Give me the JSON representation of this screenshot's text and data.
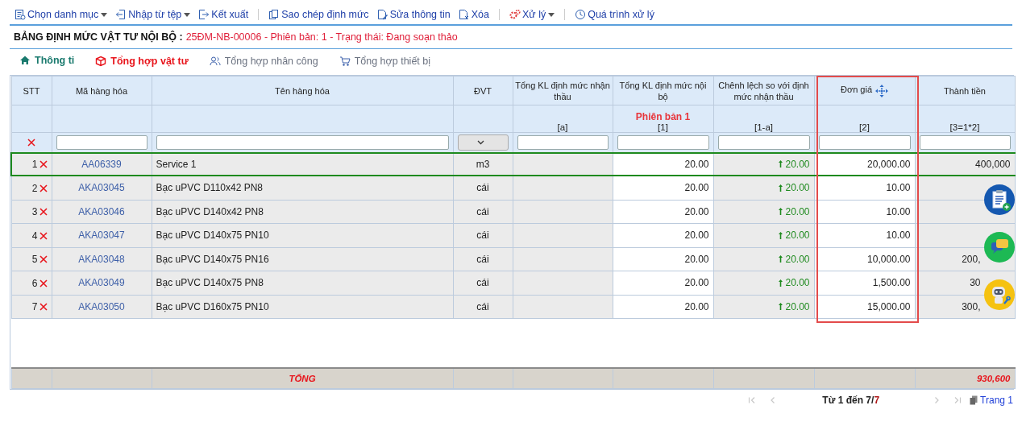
{
  "toolbar_groups": [
    [
      {
        "label": "Chọn danh mục",
        "kind": "list",
        "dropdown": true
      },
      {
        "label": "Nhập từ tệp",
        "kind": "import",
        "dropdown": true
      },
      {
        "label": "Kết xuất",
        "kind": "export",
        "dropdown": false
      }
    ],
    [
      {
        "label": "Sao chép định mức",
        "kind": "copy",
        "dropdown": false
      },
      {
        "label": "Sửa thông tin",
        "kind": "edit",
        "dropdown": false
      },
      {
        "label": "Xóa",
        "kind": "delete",
        "dropdown": false
      }
    ],
    [
      {
        "label": "Xử lý",
        "kind": "gears",
        "dropdown": true
      }
    ],
    [
      {
        "label": "Quá trình xử lý",
        "kind": "clock",
        "dropdown": false
      }
    ]
  ],
  "title": {
    "label": "BẢNG ĐỊNH MỨC VẬT TƯ NỘI BỘ :",
    "value": "25ĐM-NB-00006 - Phiên bản: 1 - Trạng thái: Đang soạn thảo"
  },
  "tabs": [
    {
      "label": "Thông ti",
      "kind": "home",
      "selected": true,
      "bold": true,
      "color": "#1a7a6e"
    },
    {
      "label": "Tổng hợp vật tư",
      "kind": "box",
      "selected": false,
      "bold": true,
      "color": "#e8141b"
    },
    {
      "label": "Tổng hợp nhân công",
      "kind": "people",
      "selected": false,
      "bold": false,
      "color": "#6b7280"
    },
    {
      "label": "Tổng hợp thiết bị",
      "kind": "cart",
      "selected": false,
      "bold": false,
      "color": "#6b7280"
    }
  ],
  "table": {
    "columns": [
      {
        "header": "STT",
        "kind": "clear",
        "highlighted": false
      },
      {
        "header": "Mã hàng hóa",
        "kind": "input",
        "highlighted": false
      },
      {
        "header": "Tên hàng hóa",
        "kind": "input",
        "highlighted": false
      },
      {
        "header": "ĐVT",
        "kind": "select",
        "highlighted": false
      },
      {
        "header": "Tổng KL định mức nhận thầu",
        "subheader": "[a]",
        "kind": "input",
        "highlighted": false
      },
      {
        "header": "Tổng KL định mức nội bộ",
        "note": "Phiên bản 1",
        "subheader": "[1]",
        "kind": "input",
        "highlighted": false
      },
      {
        "header": "Chênh lệch so với định mức nhận thầu",
        "subheader": "[1-a]",
        "kind": "input",
        "highlighted": false
      },
      {
        "header": "Đơn giá",
        "subheader": "[2]",
        "kind": "input",
        "highlighted": true
      },
      {
        "header": "Thành tiền",
        "subheader": "[3=1*2]",
        "kind": "input",
        "highlighted": false
      }
    ],
    "rows": [
      {
        "stt": "1",
        "code": "AA06339",
        "name": "Service 1",
        "unit": "m3",
        "qty": "20.00",
        "diff": "20.00",
        "price": "20,000.00",
        "total": "400,000",
        "selected": true
      },
      {
        "stt": "2",
        "code": "AKA03045",
        "name": "Bạc uPVC D110x42 PN8",
        "unit": "cái",
        "qty": "20.00",
        "diff": "20.00",
        "price": "10.00",
        "selected": false
      },
      {
        "stt": "3",
        "code": "AKA03046",
        "name": "Bạc uPVC D140x42 PN8",
        "unit": "cái",
        "qty": "20.00",
        "diff": "20.00",
        "price": "10.00",
        "selected": false
      },
      {
        "stt": "4",
        "code": "AKA03047",
        "name": "Bạc uPVC D140x75 PN10",
        "unit": "cái",
        "qty": "20.00",
        "diff": "20.00",
        "price": "10.00",
        "selected": false
      },
      {
        "stt": "5",
        "code": "AKA03048",
        "name": "Bạc uPVC D140x75 PN16",
        "unit": "cái",
        "qty": "20.00",
        "diff": "20.00",
        "price": "10,000.00",
        "total": "200,",
        "selected": false
      },
      {
        "stt": "6",
        "code": "AKA03049",
        "name": "Bạc uPVC D140x75 PN8",
        "unit": "cái",
        "qty": "20.00",
        "diff": "20.00",
        "price": "1,500.00",
        "total": "30",
        "selected": false
      },
      {
        "stt": "7",
        "code": "AKA03050",
        "name": "Bạc uPVC D160x75 PN10",
        "unit": "cái",
        "qty": "20.00",
        "diff": "20.00",
        "price": "15,000.00",
        "total": "300,",
        "selected": false
      }
    ],
    "footer": {
      "label": "TỔNG",
      "total": "930,600"
    }
  },
  "pagination": {
    "range": "Từ 1 đến 7/",
    "count": "7",
    "page": "Trang 1"
  },
  "floating_buttons": [
    {
      "kind": "clipboard",
      "color": "#1558b0"
    },
    {
      "kind": "chat",
      "color": "#1db954"
    },
    {
      "kind": "robot",
      "color": "#f5c211"
    }
  ]
}
